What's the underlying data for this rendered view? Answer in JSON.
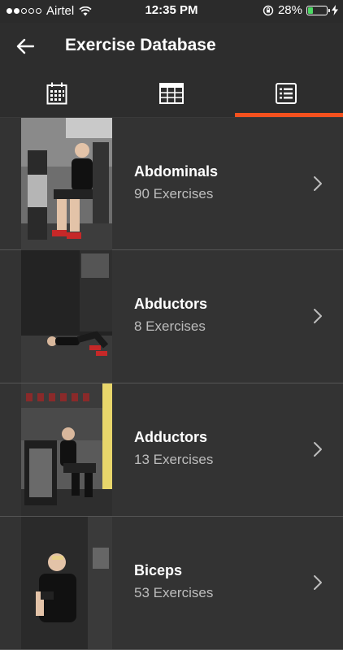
{
  "status_bar": {
    "carrier": "Airtel",
    "time": "12:35 PM",
    "battery": "28%",
    "battery_level": 0.28,
    "signal_bars_filled": 2,
    "signal_bars_total": 5
  },
  "header": {
    "title": "Exercise Database",
    "back_icon": "arrow-left-icon"
  },
  "tabs": [
    {
      "icon": "calendar-icon",
      "active": false
    },
    {
      "icon": "table-icon",
      "active": false
    },
    {
      "icon": "list-icon",
      "active": true
    }
  ],
  "accent_color": "#f4511e",
  "items": [
    {
      "title": "Abdominals",
      "count": "90 Exercises",
      "thumbnail": "man-on-ab-machine"
    },
    {
      "title": "Abductors",
      "count": "8 Exercises",
      "thumbnail": "man-lying-on-floor"
    },
    {
      "title": "Adductors",
      "count": "13 Exercises",
      "thumbnail": "man-on-adductor-machine"
    },
    {
      "title": "Biceps",
      "count": "53 Exercises",
      "thumbnail": "man-holding-dumbbell"
    }
  ]
}
